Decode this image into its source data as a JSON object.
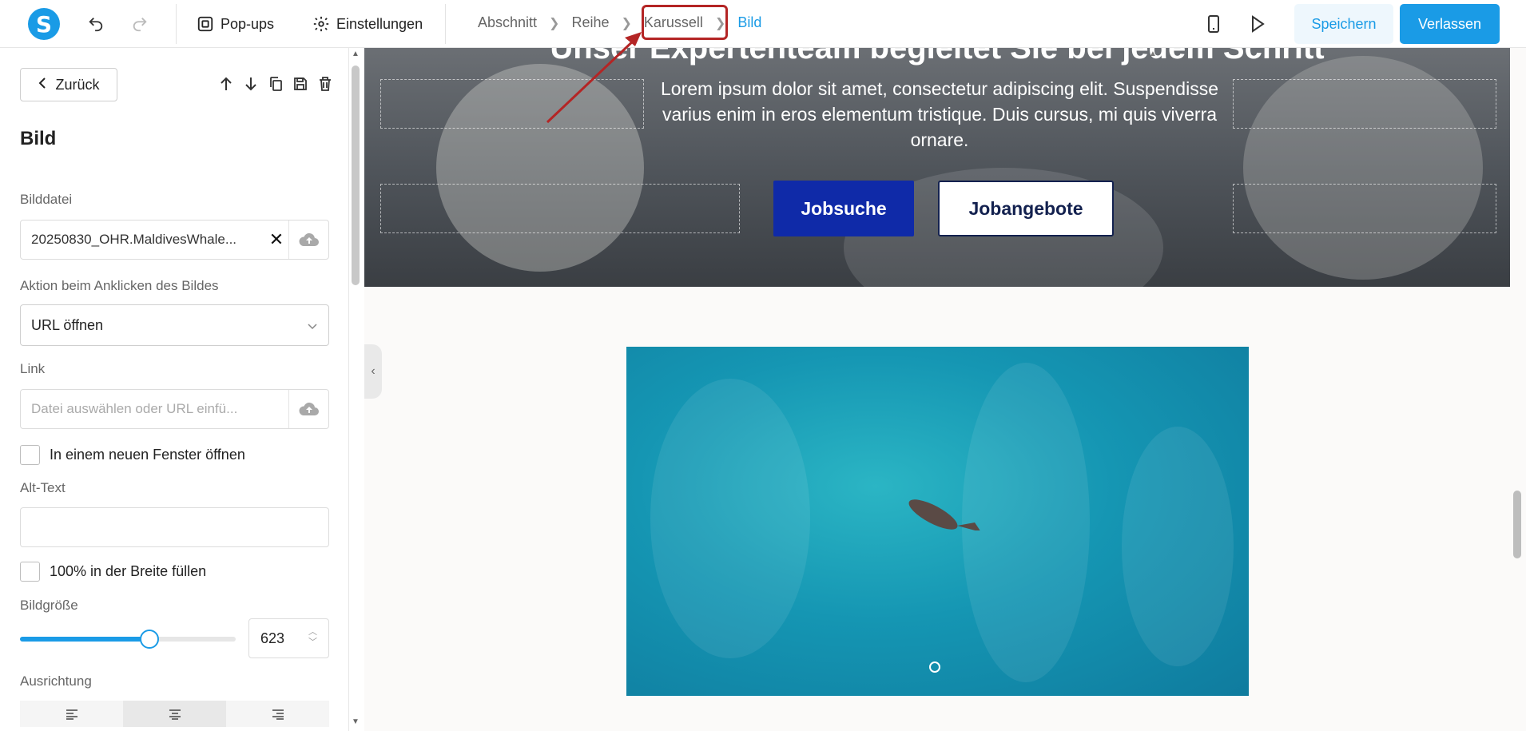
{
  "app": {
    "logo_letter": "S"
  },
  "topbar": {
    "popups_label": "Pop-ups",
    "settings_label": "Einstellungen",
    "breadcrumbs": [
      "Abschnitt",
      "Reihe",
      "Karussell",
      "Bild"
    ],
    "save_label": "Speichern",
    "exit_label": "Verlassen"
  },
  "panel": {
    "back_label": "Zurück",
    "title": "Bild",
    "image_file_label": "Bilddatei",
    "image_file_value": "20250830_OHR.MaldivesWhale...",
    "click_action_label": "Aktion beim Anklicken des Bildes",
    "click_action_value": "URL öffnen",
    "link_label": "Link",
    "link_placeholder": "Datei auswählen oder URL einfü...",
    "new_window_label": "In einem neuen Fenster öffnen",
    "alt_text_label": "Alt-Text",
    "alt_text_value": "",
    "full_width_label": "100% in der Breite füllen",
    "image_size_label": "Bildgröße",
    "image_size_value": "623",
    "image_size_fraction": 0.6,
    "alignment_label": "Ausrichtung",
    "alignment_active": "center"
  },
  "canvas": {
    "hero_heading": "Unser Expertenteam begleitet Sie bei jedem Schritt",
    "hero_text": "Lorem ipsum dolor sit amet, consectetur adipiscing elit. Suspendisse varius enim in eros elementum tristique. Duis cursus, mi quis viverra ornare.",
    "button_primary": "Jobsuche",
    "button_secondary": "Jobangebote"
  },
  "colors": {
    "accent": "#1a9be6",
    "primary_button": "#0f2aa8",
    "annotation": "#b42525"
  }
}
